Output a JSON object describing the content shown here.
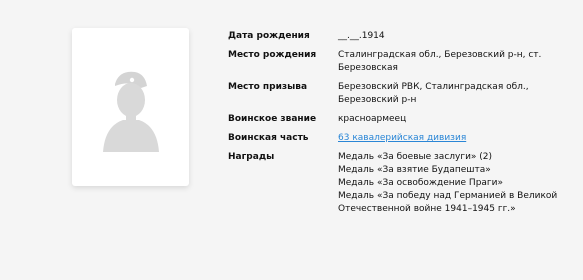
{
  "profile": {
    "birth_date_label": "Дата рождения",
    "birth_date_value": "__.__.1914",
    "birth_place_label": "Место рождения",
    "birth_place_value": "Сталинградская обл., Березовский р-н, ст. Березовская",
    "draft_place_label": "Место призыва",
    "draft_place_value": "Березовский РВК, Сталинградская обл., Березовский р-н",
    "rank_label": "Воинское звание",
    "rank_value": "красноармеец",
    "unit_label": "Воинская часть",
    "unit_value": "63 кавалерийская дивизия",
    "awards_label": "Награды",
    "awards": [
      "Медаль «За боевые заслуги» (2)",
      "Медаль «За взятие Будапешта»",
      "Медаль «За освобождение Праги»",
      "Медаль «За победу над Германией в Великой Отечественной войне 1941–1945 гг.»"
    ]
  },
  "photo": {
    "icon": "soldier-silhouette-icon"
  },
  "colors": {
    "background": "#f5f5f5",
    "link": "#2a86d6",
    "placeholder": "#d9d9d9"
  }
}
